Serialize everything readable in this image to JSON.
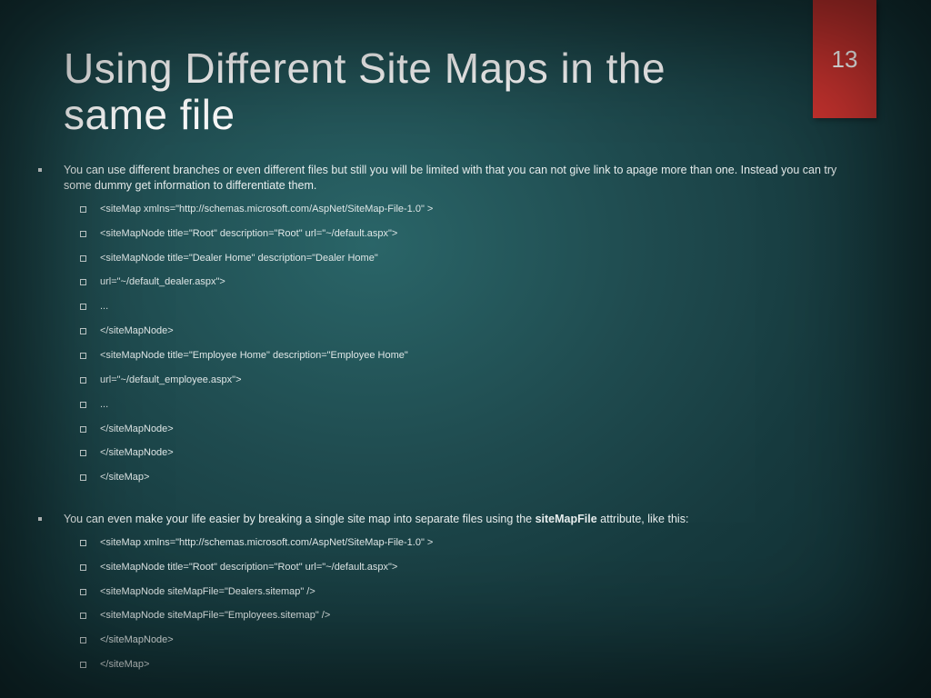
{
  "page_number": "13",
  "title": "Using Different Site Maps in the same file",
  "bullets": [
    {
      "text": "You can use different branches or even different files but still you will be limited with that you can not give link to apage more than one. Instead you can try some dummy get information to differentiate them.",
      "sub": [
        "<siteMap xmlns=\"http://schemas.microsoft.com/AspNet/SiteMap-File-1.0\" >",
        "<siteMapNode title=\"Root\" description=\"Root\" url=\"~/default.aspx\">",
        "<siteMapNode title=\"Dealer Home\" description=\"Dealer Home\"",
        "url=\"~/default_dealer.aspx\">",
        "...",
        "</siteMapNode>",
        "<siteMapNode title=\"Employee Home\" description=\"Employee Home\"",
        "url=\"~/default_employee.aspx\">",
        "...",
        "</siteMapNode>",
        "</siteMapNode>",
        "</siteMap>"
      ]
    },
    {
      "text_parts": [
        "You can even make your life easier by breaking a single site map into separate files using the ",
        "siteMapFile",
        " attribute, like this:"
      ],
      "sub": [
        "<siteMap xmlns=\"http://schemas.microsoft.com/AspNet/SiteMap-File-1.0\" >",
        "<siteMapNode title=\"Root\" description=\"Root\" url=\"~/default.aspx\">",
        "<siteMapNode siteMapFile=\"Dealers.sitemap\" />",
        "<siteMapNode siteMapFile=\"Employees.sitemap\" />",
        "</siteMapNode>",
        "</siteMap>"
      ]
    }
  ]
}
